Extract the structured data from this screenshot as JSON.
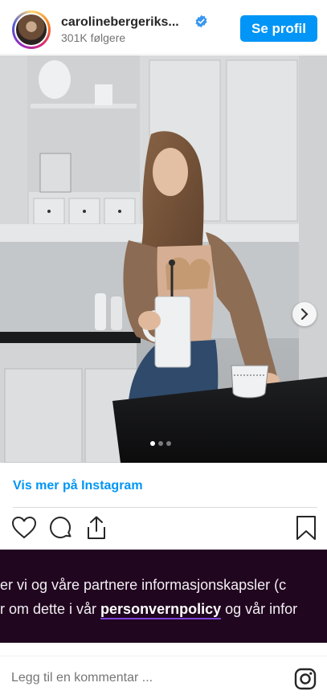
{
  "header": {
    "username": "carolinebergeriks...",
    "followers": "301K følgere",
    "profile_button": "Se profil"
  },
  "carousel": {
    "slide_count": 3,
    "active_slide": 1
  },
  "links": {
    "view_more": "Vis mer på Instagram"
  },
  "actions": {
    "icons": [
      "heart-icon",
      "comment-icon",
      "share-icon",
      "bookmark-icon"
    ]
  },
  "consent": {
    "line1": "er vi og våre partnere informasjonskapsler (c",
    "line2_before": "r om dette i vår ",
    "line2_link": "personvernpolicy",
    "line2_after": " og vår infor"
  },
  "comment_bar": {
    "placeholder": "Legg til en kommentar ..."
  },
  "colors": {
    "accent": "#0095f6",
    "consent_bg": "#20061f",
    "link_underline": "#7b45d9"
  }
}
